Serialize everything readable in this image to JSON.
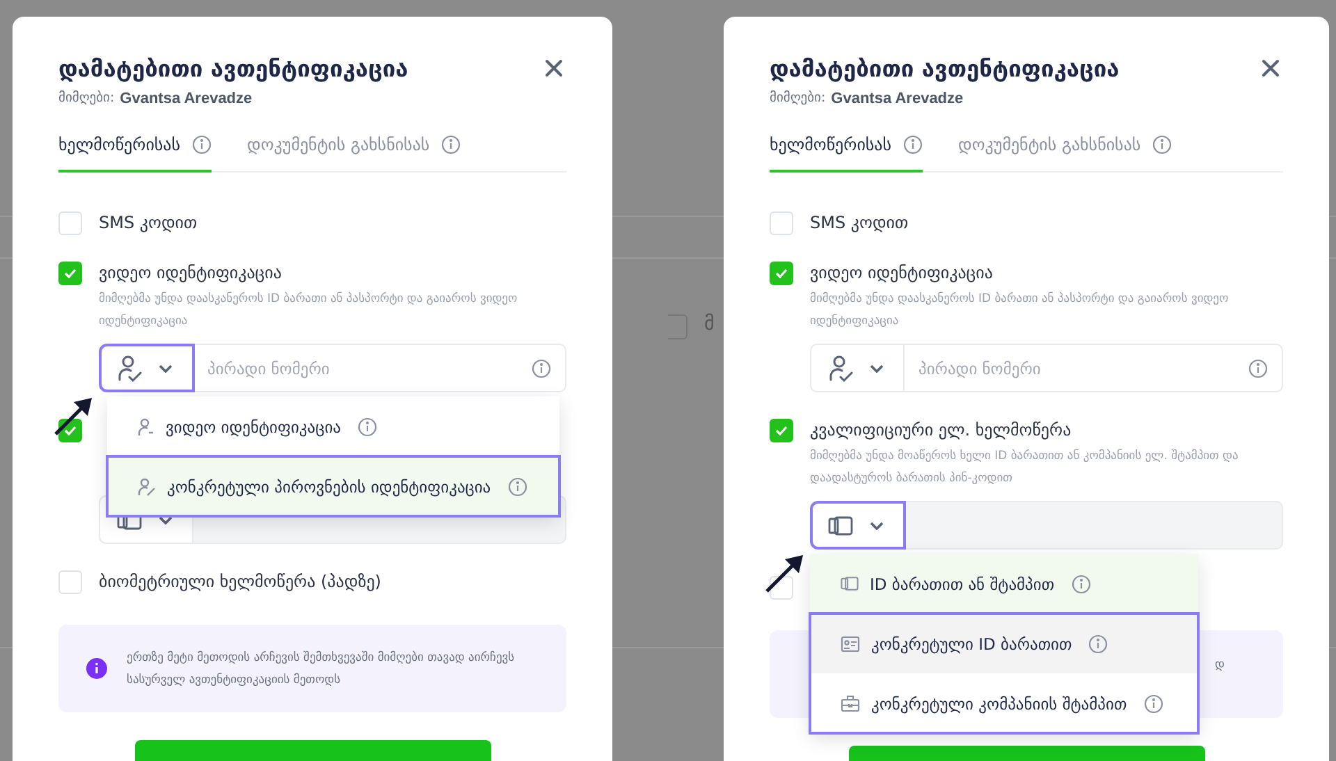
{
  "panels": [
    {
      "dialog": {
        "title": "დამატებითი ავთენტიფიკაცია",
        "recipient_label": "მიმღები:",
        "recipient_name": "Gvantsa Arevadze",
        "tabs": [
          {
            "label": "ხელმოწერისას",
            "selected": true
          },
          {
            "label": "დოკუმენტის გახსნისას",
            "selected": false
          }
        ],
        "methods": [
          {
            "label": "SMS კოდით",
            "checked": false
          },
          {
            "label": "ვიდეო იდენტიფიკაცია",
            "checked": true,
            "description": "მიმღებმა უნდა დაასკანეროს ID ბარათი ან პასპორტი და გაიაროს ვიდეო იდენტიფიკაცია",
            "field": {
              "kind": "person",
              "placeholder": "პირადი ნომერი",
              "filled": false,
              "annotated": true,
              "menu": [
                {
                  "kind": "person",
                  "label": "ვიდეო იდენტიფიკაცია",
                  "selected": false,
                  "hovered": false,
                  "outlined": false
                },
                {
                  "kind": "signer",
                  "label": "კონკრეტული პიროვნების იდენტიფიკაცია",
                  "selected": true,
                  "hovered": false,
                  "outlined": true
                }
              ]
            }
          },
          {
            "checked": true,
            "field": {
              "kind": "card",
              "filled": true,
              "annotated": false
            }
          },
          {
            "label": "ბიომეტრიული ხელმოწერა (პადზე)",
            "checked": false
          }
        ],
        "notice": {
          "kind": "full",
          "text": "ერთზე მეტი მეთოდის არჩევის შემთხვევაში მიმღები თავად აირჩევს სასურველ ავთენტიფიკაციის მეთოდს"
        }
      }
    },
    {
      "backdrop_text": "მ",
      "backdrop_checkbox": {
        "checked": false
      },
      "dialog": {
        "title": "დამატებითი ავთენტიფიკაცია",
        "recipient_label": "მიმღები:",
        "recipient_name": "Gvantsa Arevadze",
        "tabs": [
          {
            "label": "ხელმოწერისას",
            "selected": true
          },
          {
            "label": "დოკუმენტის გახსნისას",
            "selected": false
          }
        ],
        "methods": [
          {
            "label": "SMS კოდით",
            "checked": false
          },
          {
            "label": "ვიდეო იდენტიფიკაცია",
            "checked": true,
            "description": "მიმღებმა უნდა დაასკანეროს ID ბარათი ან პასპორტი და გაიაროს ვიდეო იდენტიფიკაცია",
            "field": {
              "kind": "person",
              "placeholder": "პირადი ნომერი",
              "filled": false,
              "annotated": false
            }
          },
          {
            "label": "კვალიფიციური ელ. ხელმოწერა",
            "checked": true,
            "description": "მიმღებმა უნდა მოაწეროს ხელი ID ბარათით ან კომპანიის ელ. შტამპით და დაადასტუროს ბარათის პინ-კოდით",
            "field": {
              "kind": "card",
              "filled": true,
              "annotated": true,
              "menu": [
                {
                  "kind": "card",
                  "label": "ID ბარათით ან შტამპით",
                  "selected": true,
                  "hovered": false,
                  "outlined": false
                },
                {
                  "kind": "idcard",
                  "label": "კონკრეტული ID ბარათით",
                  "selected": false,
                  "hovered": true,
                  "outlined": true
                },
                {
                  "kind": "stamp",
                  "label": "კონკრეტული კომპანიის შტამპით",
                  "selected": false,
                  "hovered": false,
                  "outlined": true
                }
              ]
            }
          },
          {
            "checked": false
          }
        ],
        "notice": {
          "kind": "tail",
          "text": "დ"
        }
      }
    }
  ]
}
